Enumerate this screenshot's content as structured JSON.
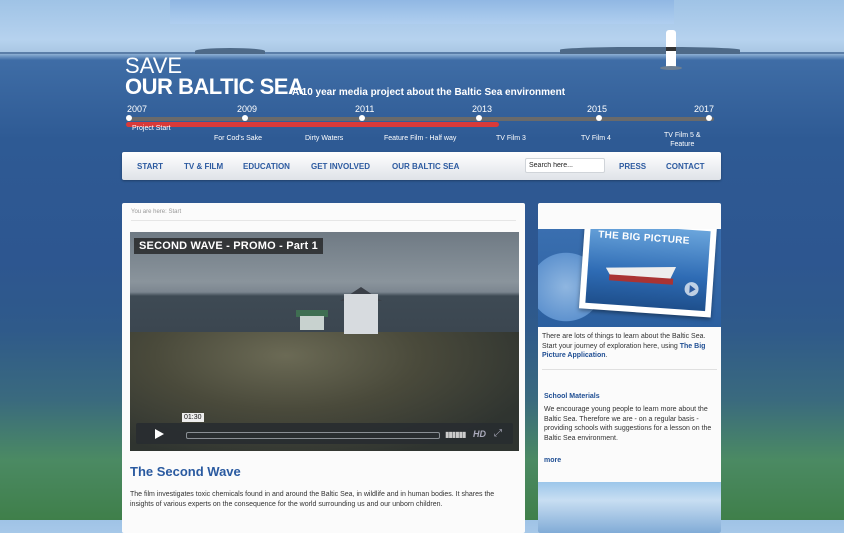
{
  "header": {
    "logo_line1": "SAVE",
    "logo_line2": "OUR BALTIC SEA",
    "tagline": "A 10 year media project about the Baltic Sea environment"
  },
  "timeline": {
    "years": [
      "2007",
      "2009",
      "2011",
      "2013",
      "2015",
      "2017"
    ],
    "milestones": [
      {
        "label": "Project Start"
      },
      {
        "label": "For Cod's Sake"
      },
      {
        "label": "Dirty Waters"
      },
      {
        "label": "Feature Film - Half way"
      },
      {
        "label": "TV Film 3"
      },
      {
        "label": "TV Film 4"
      },
      {
        "label": "TV Film 5 &",
        "label2": "Feature"
      }
    ],
    "progress": 0.635,
    "colors": {
      "progress": "#d83a3a"
    }
  },
  "nav": {
    "items": [
      "START",
      "TV & FILM",
      "EDUCATION",
      "GET INVOLVED",
      "OUR BALTIC SEA"
    ],
    "search_placeholder": "Search here...",
    "right_items": [
      "PRESS",
      "CONTACT"
    ]
  },
  "main": {
    "breadcrumb": "You are here:  Start",
    "video": {
      "title": "SECOND WAVE - PROMO - Part 1",
      "time": "01:30",
      "hd_label": "HD"
    },
    "post_title": "The Second Wave",
    "post_body": "The film investigates toxic chemicals found in and around the Baltic Sea, in wildlife and in human bodies. It shares the insights of various experts on the consequence for the world surrounding us and our unborn children."
  },
  "sidebar": {
    "big_picture_title": "THE BIG PICTURE",
    "intro_text": "There are lots of things to learn about the Baltic Sea. Start your journey of exploration here, using ",
    "intro_link": "The Big Picture Application",
    "intro_end": ".",
    "school_title": "School Materials",
    "school_body": "We encourage young people to learn more about the Baltic Sea. Therefore we are  - on a regular basis - providing schools with suggestions for a lesson on the Baltic Sea environment.",
    "more": "more"
  }
}
